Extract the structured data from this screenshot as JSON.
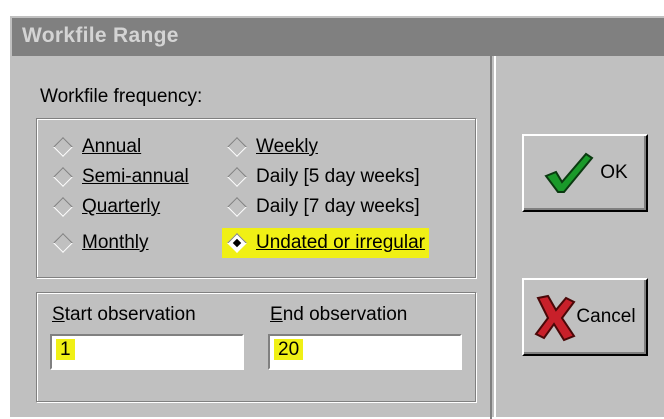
{
  "window": {
    "title": "Workfile Range"
  },
  "frequency": {
    "label": "Workfile frequency:",
    "options": [
      {
        "label": "Annual",
        "selected": false
      },
      {
        "label": "Semi-annual",
        "selected": false
      },
      {
        "label": "Quarterly",
        "selected": false
      },
      {
        "label": "Monthly",
        "selected": false
      },
      {
        "label": "Weekly",
        "selected": false
      },
      {
        "label": "Daily [5 day weeks]",
        "selected": false
      },
      {
        "label": "Daily [7 day weeks]",
        "selected": false
      },
      {
        "label": "Undated or irregular",
        "selected": true
      }
    ]
  },
  "observations": {
    "start_label": "Start observation",
    "start_value": "1",
    "end_label": "End observation",
    "end_value": "20"
  },
  "buttons": {
    "ok_label": "OK",
    "cancel_label": "Cancel"
  },
  "colors": {
    "highlight": "#f0f015",
    "dialog_bg": "#c0c0c0",
    "titlebar": "#808080",
    "check_green": "#1a9a2a",
    "cancel_red": "#c8202a"
  }
}
